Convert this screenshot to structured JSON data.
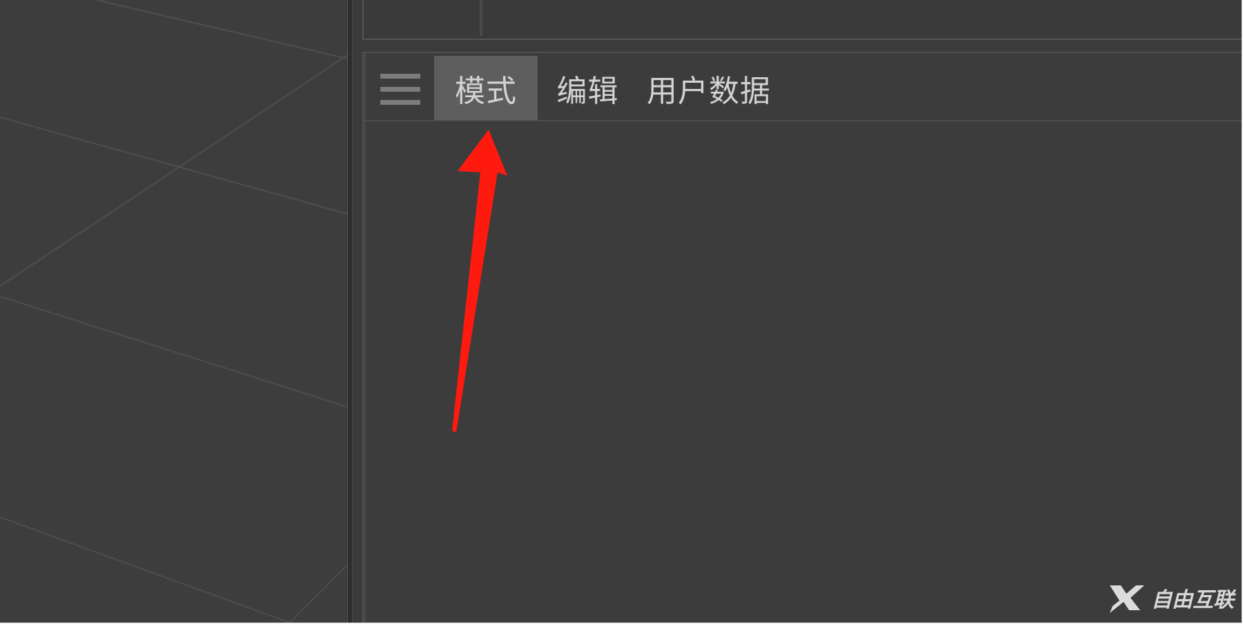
{
  "tabs": [
    {
      "label": "模式",
      "active": true
    },
    {
      "label": "编辑",
      "active": false
    },
    {
      "label": "用户数据",
      "active": false
    }
  ],
  "watermark": {
    "text": "自由互联",
    "icon": "x-logo-icon"
  },
  "colors": {
    "background": "#3b3b3b",
    "active_tab": "#5e5e5e",
    "tab_text": "#d3d3d3",
    "annotation_arrow": "#ff1a10"
  }
}
